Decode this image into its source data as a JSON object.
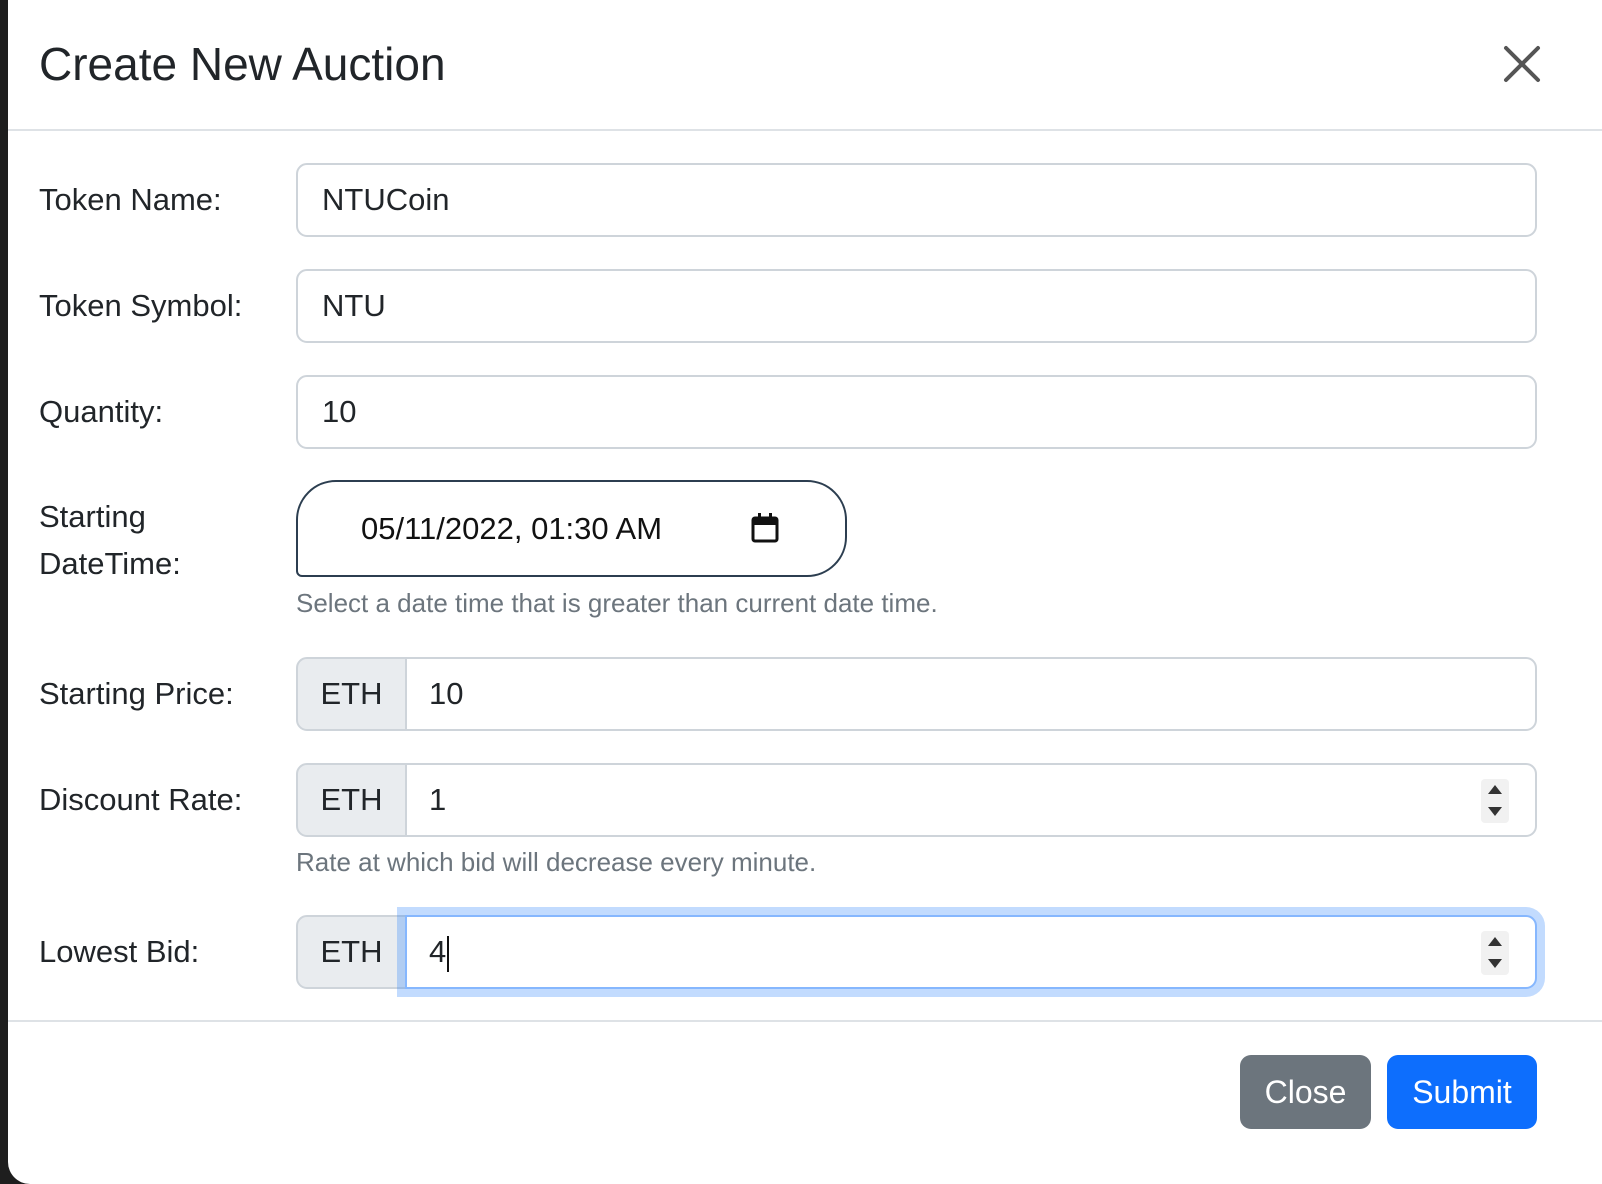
{
  "modal": {
    "title": "Create New Auction"
  },
  "form": {
    "token_name": {
      "label": "Token Name:",
      "value": "NTUCoin"
    },
    "token_symbol": {
      "label": "Token Symbol:",
      "value": "NTU"
    },
    "quantity": {
      "label": "Quantity:",
      "value": "10"
    },
    "starting_datetime": {
      "label_line1": "Starting",
      "label_line2": "DateTime:",
      "value": "05/11/2022, 01:30  AM",
      "help": "Select a date time that is greater than current date time."
    },
    "starting_price": {
      "label": "Starting Price:",
      "addon": "ETH",
      "value": "10"
    },
    "discount_rate": {
      "label": "Discount Rate:",
      "addon": "ETH",
      "value": "1",
      "help": "Rate at which bid will decrease every minute."
    },
    "lowest_bid": {
      "label": "Lowest Bid:",
      "addon": "ETH",
      "value": "4"
    }
  },
  "footer": {
    "close_label": "Close",
    "submit_label": "Submit"
  },
  "colors": {
    "primary": "#0d6efd",
    "secondary": "#6c757d",
    "focus_ring": "#86b7fe"
  },
  "icons": {
    "close": "close-icon",
    "calendar": "calendar-icon"
  }
}
